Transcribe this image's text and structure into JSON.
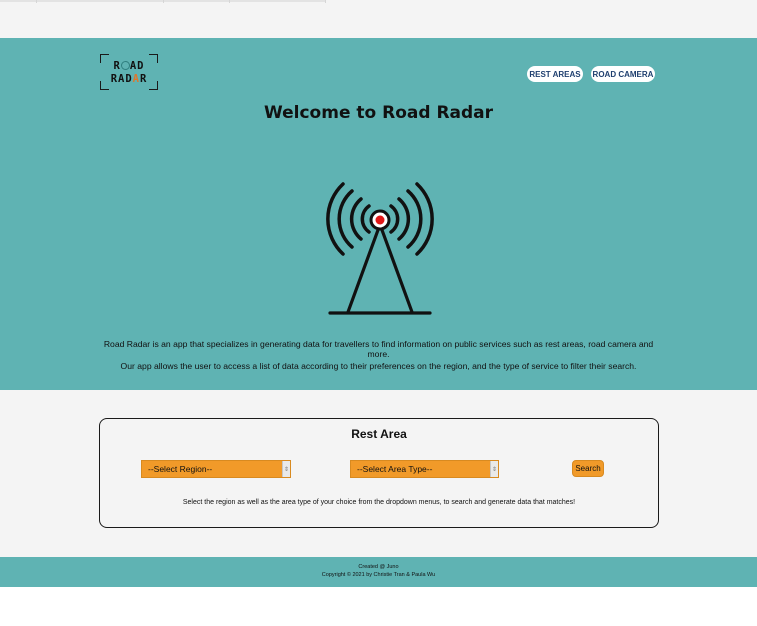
{
  "logo": {
    "line1_left": "R",
    "line1_right": "AD",
    "line2_left": "RAD",
    "line2_accent": "A",
    "line2_right": "R"
  },
  "nav": {
    "rest_areas": "REST AREAS",
    "road_camera": "ROAD CAMERA"
  },
  "hero": {
    "title": "Welcome to Road Radar",
    "intro_1": "Road Radar is an app that specializes in generating data for travellers to find information on public services such as rest areas, road camera and more.",
    "intro_2": "Our app allows the user to access a list of data according to their preferences on the region, and the type of service to filter their search."
  },
  "search_card": {
    "title": "Rest Area",
    "region_select": "--Select Region--",
    "area_type_select": "--Select Area Type--",
    "search_button": "Search",
    "help_text": "Select the region as well as the area type of your choice from the dropdown menus, to search and generate data that matches!"
  },
  "footer": {
    "line1": "Created @ Juno",
    "line2": "Copyright © 2021 by Christie Tran & Paula Wu"
  },
  "colors": {
    "teal": "#5fb3b3",
    "orange": "#f19a29",
    "tower_light": "#e01818",
    "page_gray": "#f4f4f4"
  },
  "icons": {
    "tower": "radio-tower-icon",
    "select_arrow": "chevron-updown-icon"
  }
}
